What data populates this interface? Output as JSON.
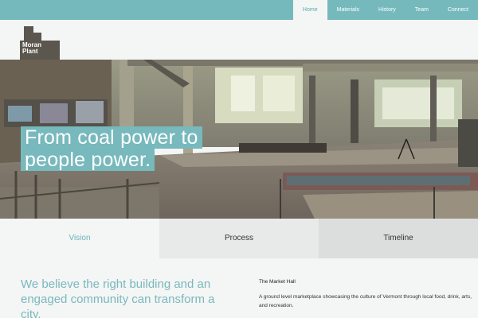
{
  "nav": {
    "items": [
      {
        "label": "Home",
        "active": true
      },
      {
        "label": "Materials",
        "active": false
      },
      {
        "label": "History",
        "active": false
      },
      {
        "label": "Team",
        "active": false
      },
      {
        "label": "Connect",
        "active": false
      }
    ]
  },
  "logo": {
    "line1": "Moran",
    "line2": "Plant"
  },
  "hero": {
    "line1": "From coal power to",
    "line2": "people power."
  },
  "tabs": [
    {
      "label": "Vision"
    },
    {
      "label": "Process"
    },
    {
      "label": "Timeline"
    }
  ],
  "content": {
    "intro": "We believe the right building and an engaged community can transform a city.",
    "side_title": "The Market Hall",
    "side_text": "A ground level marketplace showcasing the culture of Vermont through local food, drink, arts, and recreation."
  },
  "colors": {
    "accent": "#75b9bd",
    "logo": "#5c574e"
  }
}
